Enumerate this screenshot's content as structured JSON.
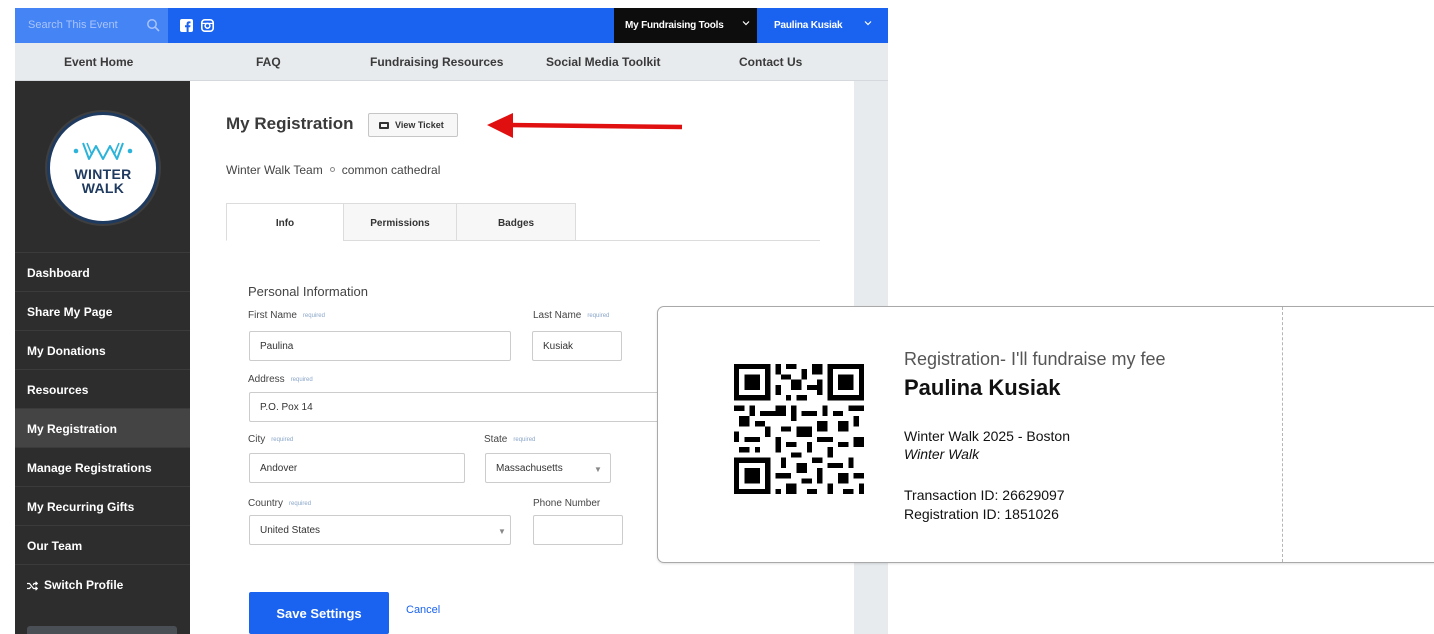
{
  "topbar": {
    "search_placeholder": "Search This Event",
    "tools_label": "My Fundraising Tools",
    "user_label": "Paulina Kusiak"
  },
  "nav": {
    "items": [
      "Event Home",
      "FAQ",
      "Fundraising Resources",
      "Social Media Toolkit",
      "Contact Us"
    ]
  },
  "logo": {
    "line1": "WINTER",
    "line2": "WALK"
  },
  "sidebar": {
    "items": [
      {
        "label": "Dashboard",
        "active": false
      },
      {
        "label": "Share My Page",
        "active": false
      },
      {
        "label": "My Donations",
        "active": false
      },
      {
        "label": "Resources",
        "active": false
      },
      {
        "label": "My Registration",
        "active": true
      },
      {
        "label": "Manage Registrations",
        "active": false
      },
      {
        "label": "My Recurring Gifts",
        "active": false
      },
      {
        "label": "Our Team",
        "active": false
      },
      {
        "label": "Switch Profile",
        "active": false
      }
    ]
  },
  "registration": {
    "title": "My Registration",
    "view_ticket_label": "View Ticket",
    "team": "Winter Walk Team",
    "team_location": "common cathedral",
    "tabs": [
      "Info",
      "Permissions",
      "Badges"
    ],
    "active_tab": "Info"
  },
  "form": {
    "section_title": "Personal Information",
    "required_tag": "required",
    "first_name": {
      "label": "First Name",
      "value": "Paulina"
    },
    "last_name": {
      "label": "Last Name",
      "value": "Kusiak"
    },
    "address": {
      "label": "Address",
      "value": "P.O. Pox 14"
    },
    "city": {
      "label": "City",
      "value": "Andover"
    },
    "state": {
      "label": "State",
      "value": "Massachusetts"
    },
    "country": {
      "label": "Country",
      "value": "United States"
    },
    "phone": {
      "label": "Phone Number",
      "value": ""
    },
    "save_label": "Save Settings",
    "cancel_label": "Cancel"
  },
  "ticket": {
    "type": "Registration- I'll fundraise my fee",
    "name": "Paulina Kusiak",
    "event": "Winter Walk 2025 - Boston",
    "org": "Winter Walk",
    "transaction": "Transaction ID: 26629097",
    "registration": "Registration ID: 1851026"
  },
  "colors": {
    "brand_blue": "#1a63f0",
    "sidebar_bg": "#2d2d2d",
    "arrow_red": "#e01010"
  }
}
